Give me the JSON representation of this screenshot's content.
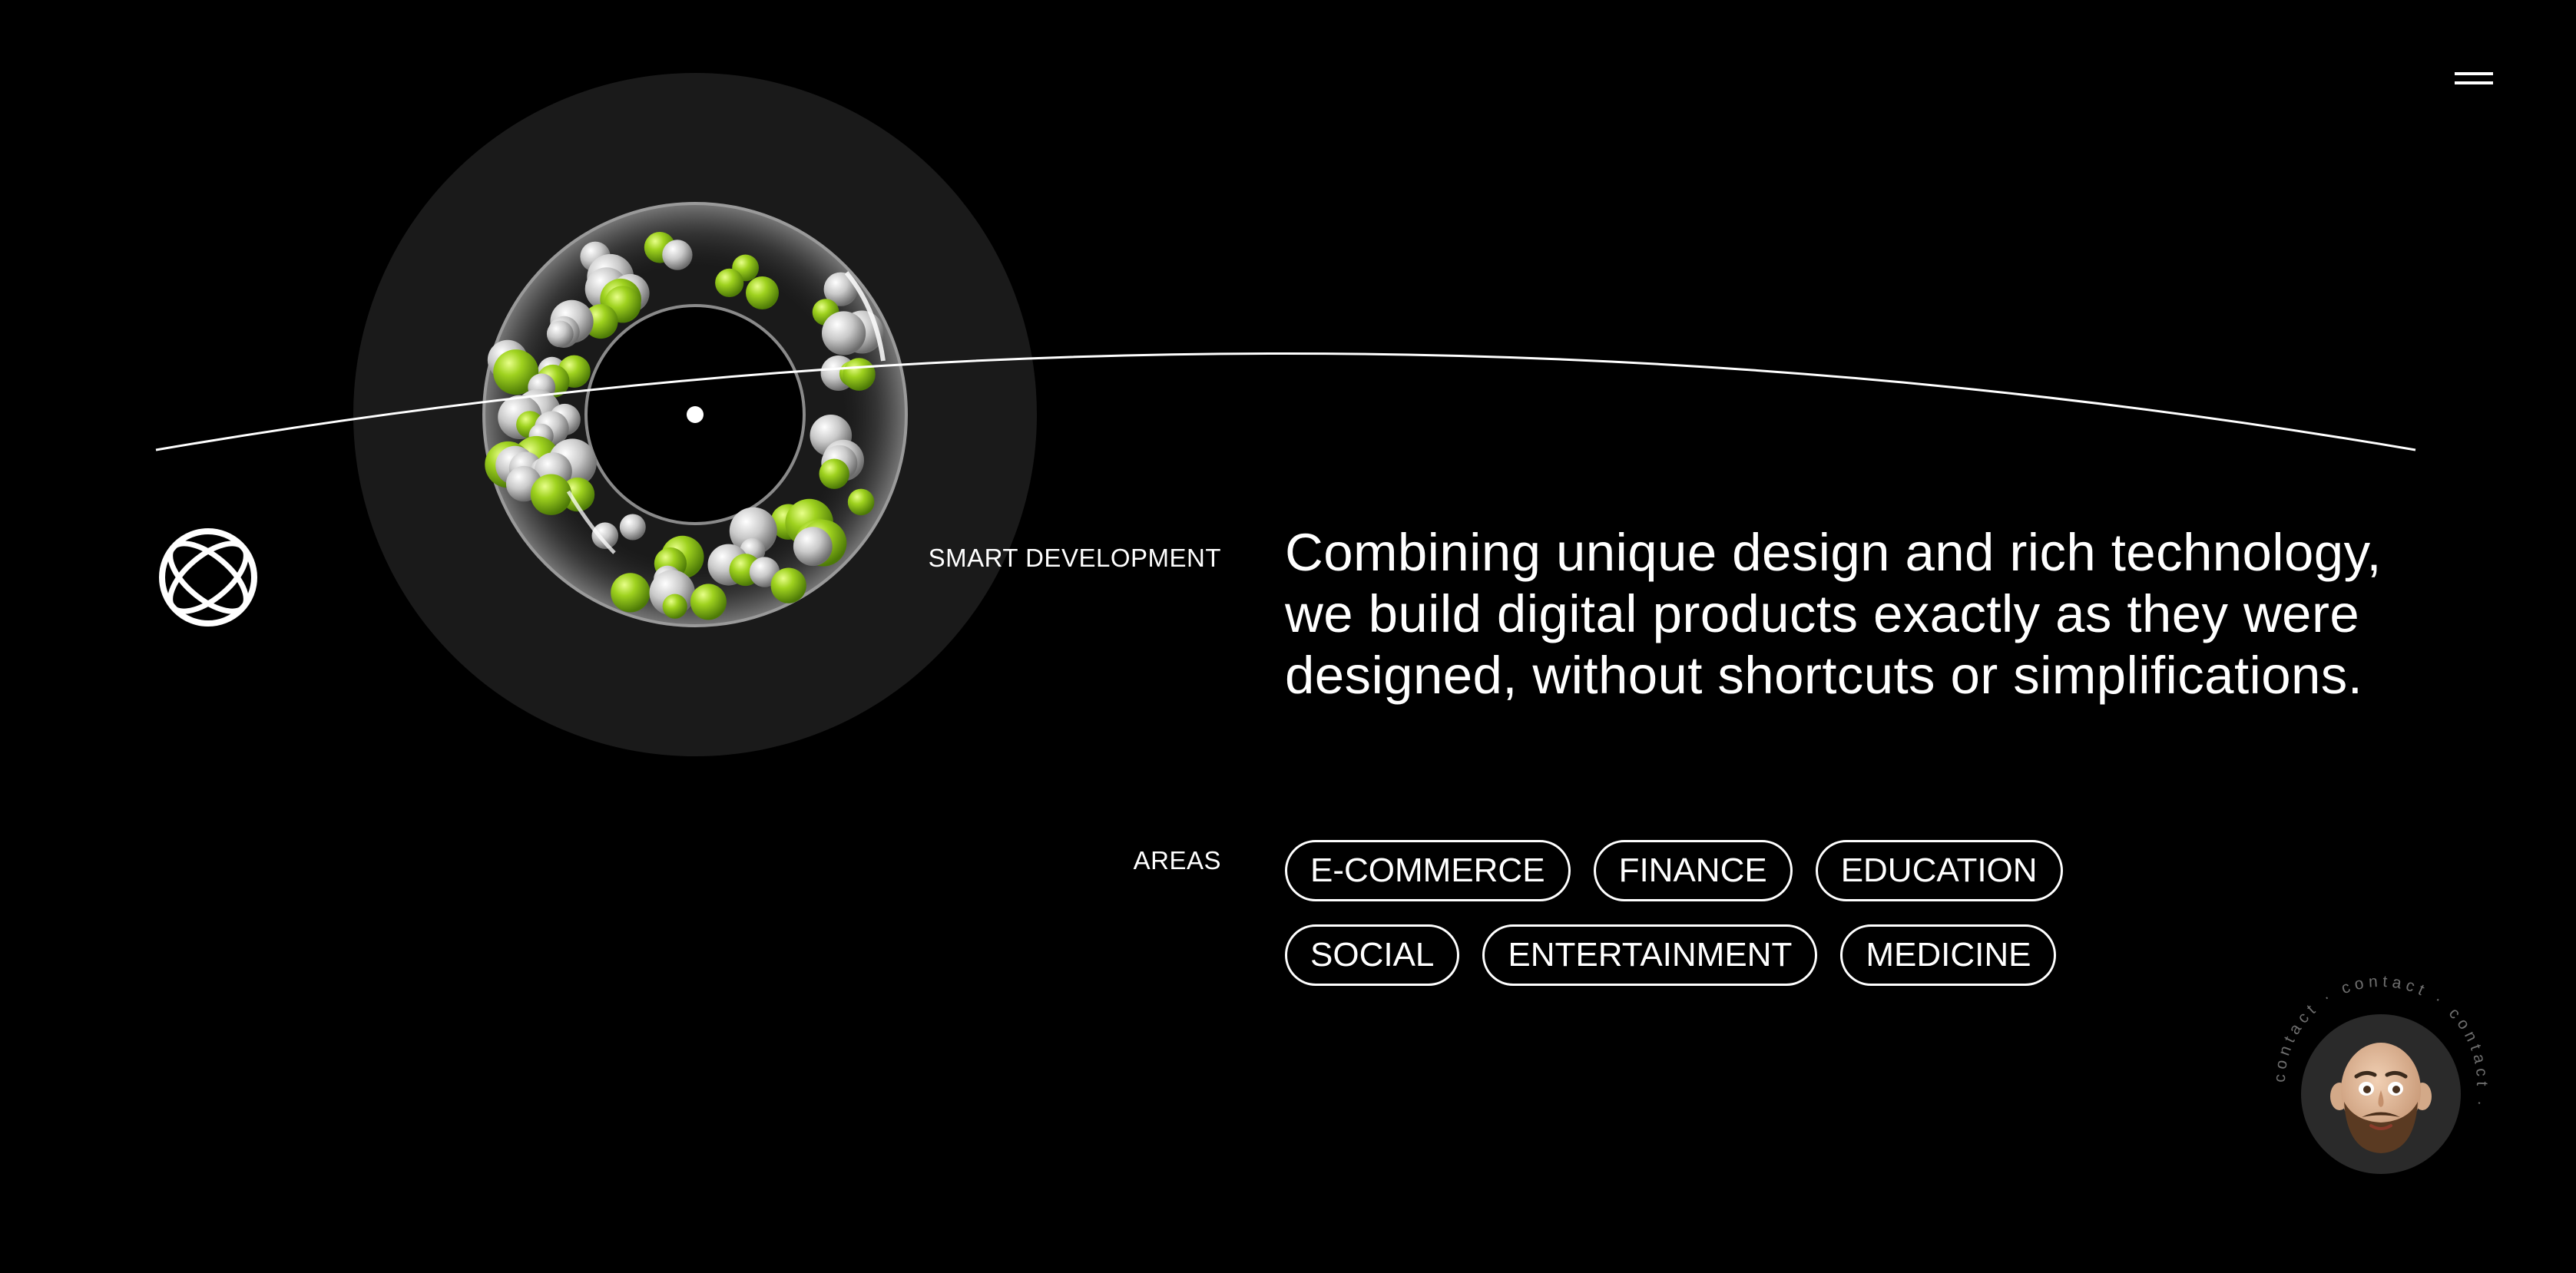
{
  "header": {
    "menu_icon": "hamburger-menu-icon"
  },
  "brand": {
    "logo_icon": "globe-crossed-logo"
  },
  "hero": {
    "visual": "glass-torus-with-green-and-white-spheres"
  },
  "smart_development": {
    "label": "SMART DEVELOPMENT",
    "headline_line1": "Combining unique design and rich technology,",
    "headline_line2": "we build digital products exactly as they were",
    "headline_line3": "designed, without shortcuts or simplifications."
  },
  "areas": {
    "label": "AREAS",
    "row1": [
      "E-COMMERCE",
      "FINANCE",
      "EDUCATION"
    ],
    "row2": [
      "SOCIAL",
      "ENTERTAINMENT",
      "MEDICINE"
    ]
  },
  "contact": {
    "ring_text": "contact · contact · contact · ",
    "avatar": "bald-bearded-man-avatar"
  },
  "colors": {
    "background": "#000000",
    "foreground": "#ffffff",
    "halo": "#1a1a1a",
    "accent_green": "#9acd1e"
  }
}
